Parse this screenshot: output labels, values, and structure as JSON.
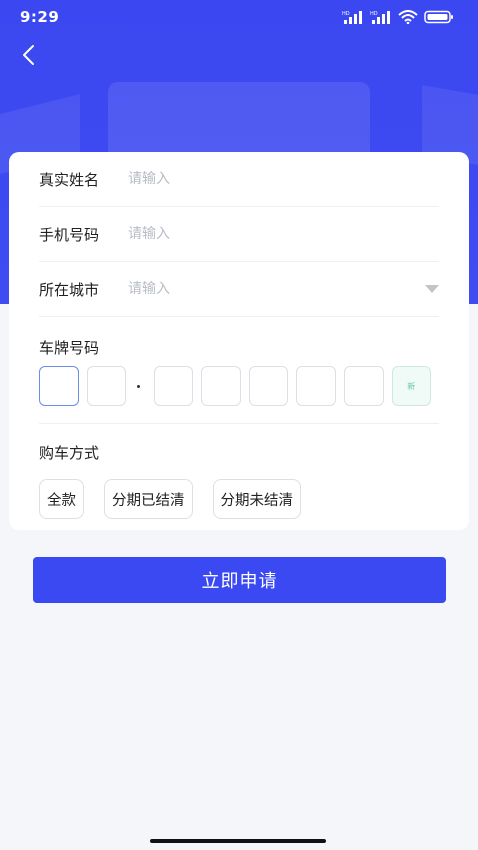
{
  "status_bar": {
    "time": "9:29",
    "network_1": "HD",
    "network_2": "HD"
  },
  "form": {
    "name": {
      "label": "真实姓名",
      "placeholder": "请输入"
    },
    "phone": {
      "label": "手机号码",
      "placeholder": "请输入"
    },
    "city": {
      "label": "所在城市",
      "placeholder": "请输入"
    },
    "plate": {
      "label": "车牌号码",
      "new_energy_label": "新",
      "box_count": 8
    },
    "purchase": {
      "label": "购车方式",
      "options": [
        "全款",
        "分期已结清",
        "分期未结清"
      ]
    }
  },
  "submit_label": "立即申请",
  "colors": {
    "primary": "#3a49f2",
    "hero": "#3f4cf2",
    "background": "#f5f6fa"
  },
  "icons": {
    "back": "chevron-left-icon",
    "dropdown": "caret-down-icon"
  }
}
